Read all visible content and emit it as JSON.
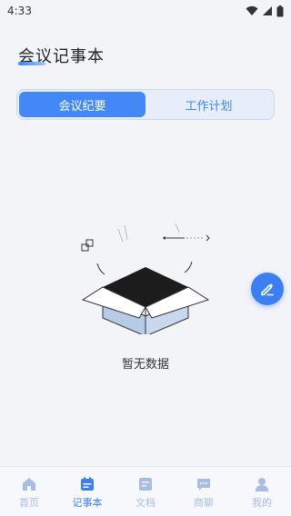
{
  "status_bar": {
    "time": "4:33"
  },
  "header": {
    "title": "会议记事本"
  },
  "tabs": [
    {
      "label": "会议纪要",
      "active": true
    },
    {
      "label": "工作计划",
      "active": false
    }
  ],
  "empty_state": {
    "text": "暂无数据"
  },
  "fab": {
    "icon": "edit-icon"
  },
  "bottom_nav": [
    {
      "label": "首页",
      "icon": "home-icon",
      "active": false
    },
    {
      "label": "记事本",
      "icon": "calendar-icon",
      "active": true
    },
    {
      "label": "文档",
      "icon": "document-icon",
      "active": false
    },
    {
      "label": "商聊",
      "icon": "chat-icon",
      "active": false
    },
    {
      "label": "我的",
      "icon": "user-icon",
      "active": false
    }
  ],
  "colors": {
    "accent": "#3d7ff3",
    "inactive_nav": "#a9bde3",
    "background": "#f2f4f8"
  }
}
